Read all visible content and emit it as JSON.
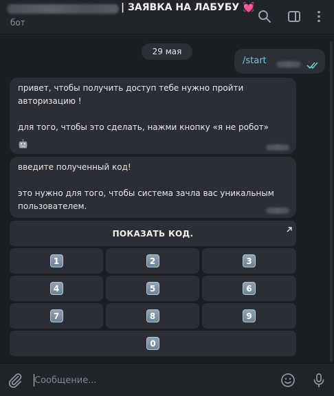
{
  "header": {
    "title": "| ЗАЯВКА НА ЛАБУБУ 💓",
    "subtitle": "бот"
  },
  "chat": {
    "date": "29 мая",
    "outgoing": {
      "text": "/start"
    },
    "message1": {
      "lines": [
        "привет, чтобы получить доступ тебе нужно пройти",
        "авторизацию !",
        "",
        "для того, чтобы это сделать, нажми кнопку «я не робот»"
      ],
      "emoji": "🤖"
    },
    "message2": {
      "lines": [
        "введите полученный код!",
        "",
        "это нужно для того, чтобы система зачла вас уникальным",
        "пользователем."
      ]
    }
  },
  "keyboard": {
    "show_code_label": "ПОКАЗАТЬ КОД.",
    "keys": [
      "1",
      "2",
      "3",
      "4",
      "5",
      "6",
      "7",
      "8",
      "9",
      "0"
    ]
  },
  "composer": {
    "placeholder": "Сообщение..."
  },
  "colors": {
    "accent": "#6fc9d8",
    "bubble": "#2b2f35",
    "background": "#1b1e22"
  },
  "icons": {
    "header": [
      "search-icon",
      "sidebar-toggle-icon",
      "more-vertical-icon"
    ],
    "composer": [
      "attach-icon",
      "emoji-icon",
      "microphone-icon"
    ],
    "message": [
      "double-check-icon",
      "open-link-arrow-icon"
    ]
  }
}
